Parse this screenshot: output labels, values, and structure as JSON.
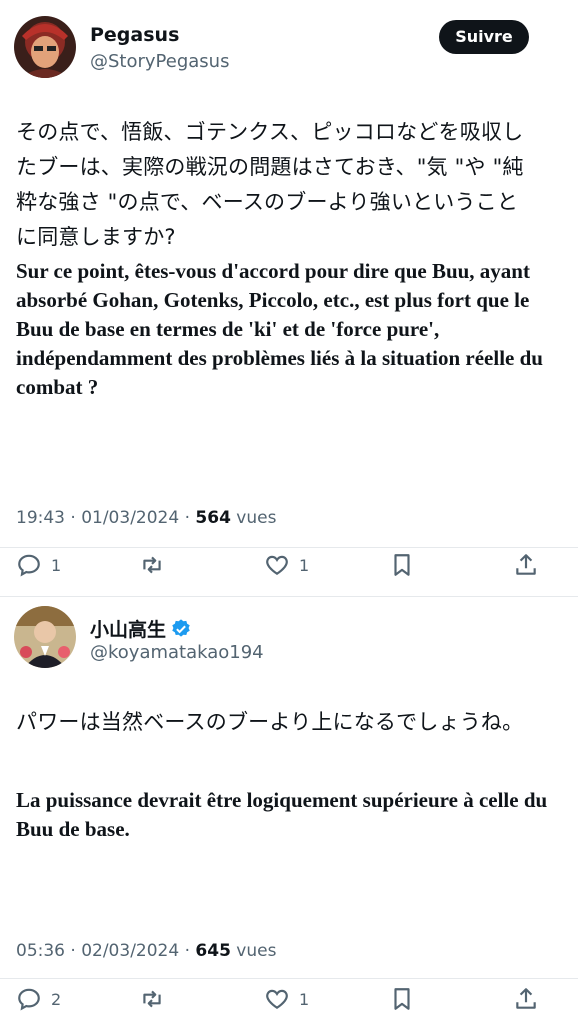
{
  "tweet1": {
    "author_name": "Pegasus",
    "author_handle": "@StoryPegasus",
    "follow_label": "Suivre",
    "text_jp": "その点で、悟飯、ゴテンクス、ピッコロなどを吸収したブーは、実際の戦況の問題はさておき、\"気 \"や \"純粋な強さ \"の点で、ベースのブーより強いということに同意しますか?",
    "text_fr": "Sur ce point, êtes-vous d'accord pour dire que Buu, ayant absorbé Gohan, Gotenks, Piccolo, etc., est plus fort que le Buu de base en termes de 'ki' et de 'force pure', indépendamment des problèmes liés à la situation réelle du combat ?",
    "timestamp": "19:43 · 01/03/2024 · ",
    "views_count": "564",
    "views_label": " vues",
    "reply_count": "1",
    "like_count": "1"
  },
  "tweet2": {
    "author_name": "小山高生",
    "author_handle": "@koyamatakao194",
    "text_jp": "パワーは当然ベースのブーより上になるでしょうね。",
    "text_fr": "La puissance devrait être logiquement supérieure à celle du Buu de base.",
    "timestamp": "05:36 · 02/03/2024 · ",
    "views_count": "645",
    "views_label": " vues",
    "reply_count": "2",
    "like_count": "1"
  },
  "colors": {
    "text": "#0f1419",
    "secondary": "#536471",
    "verified": "#1d9bf0"
  }
}
